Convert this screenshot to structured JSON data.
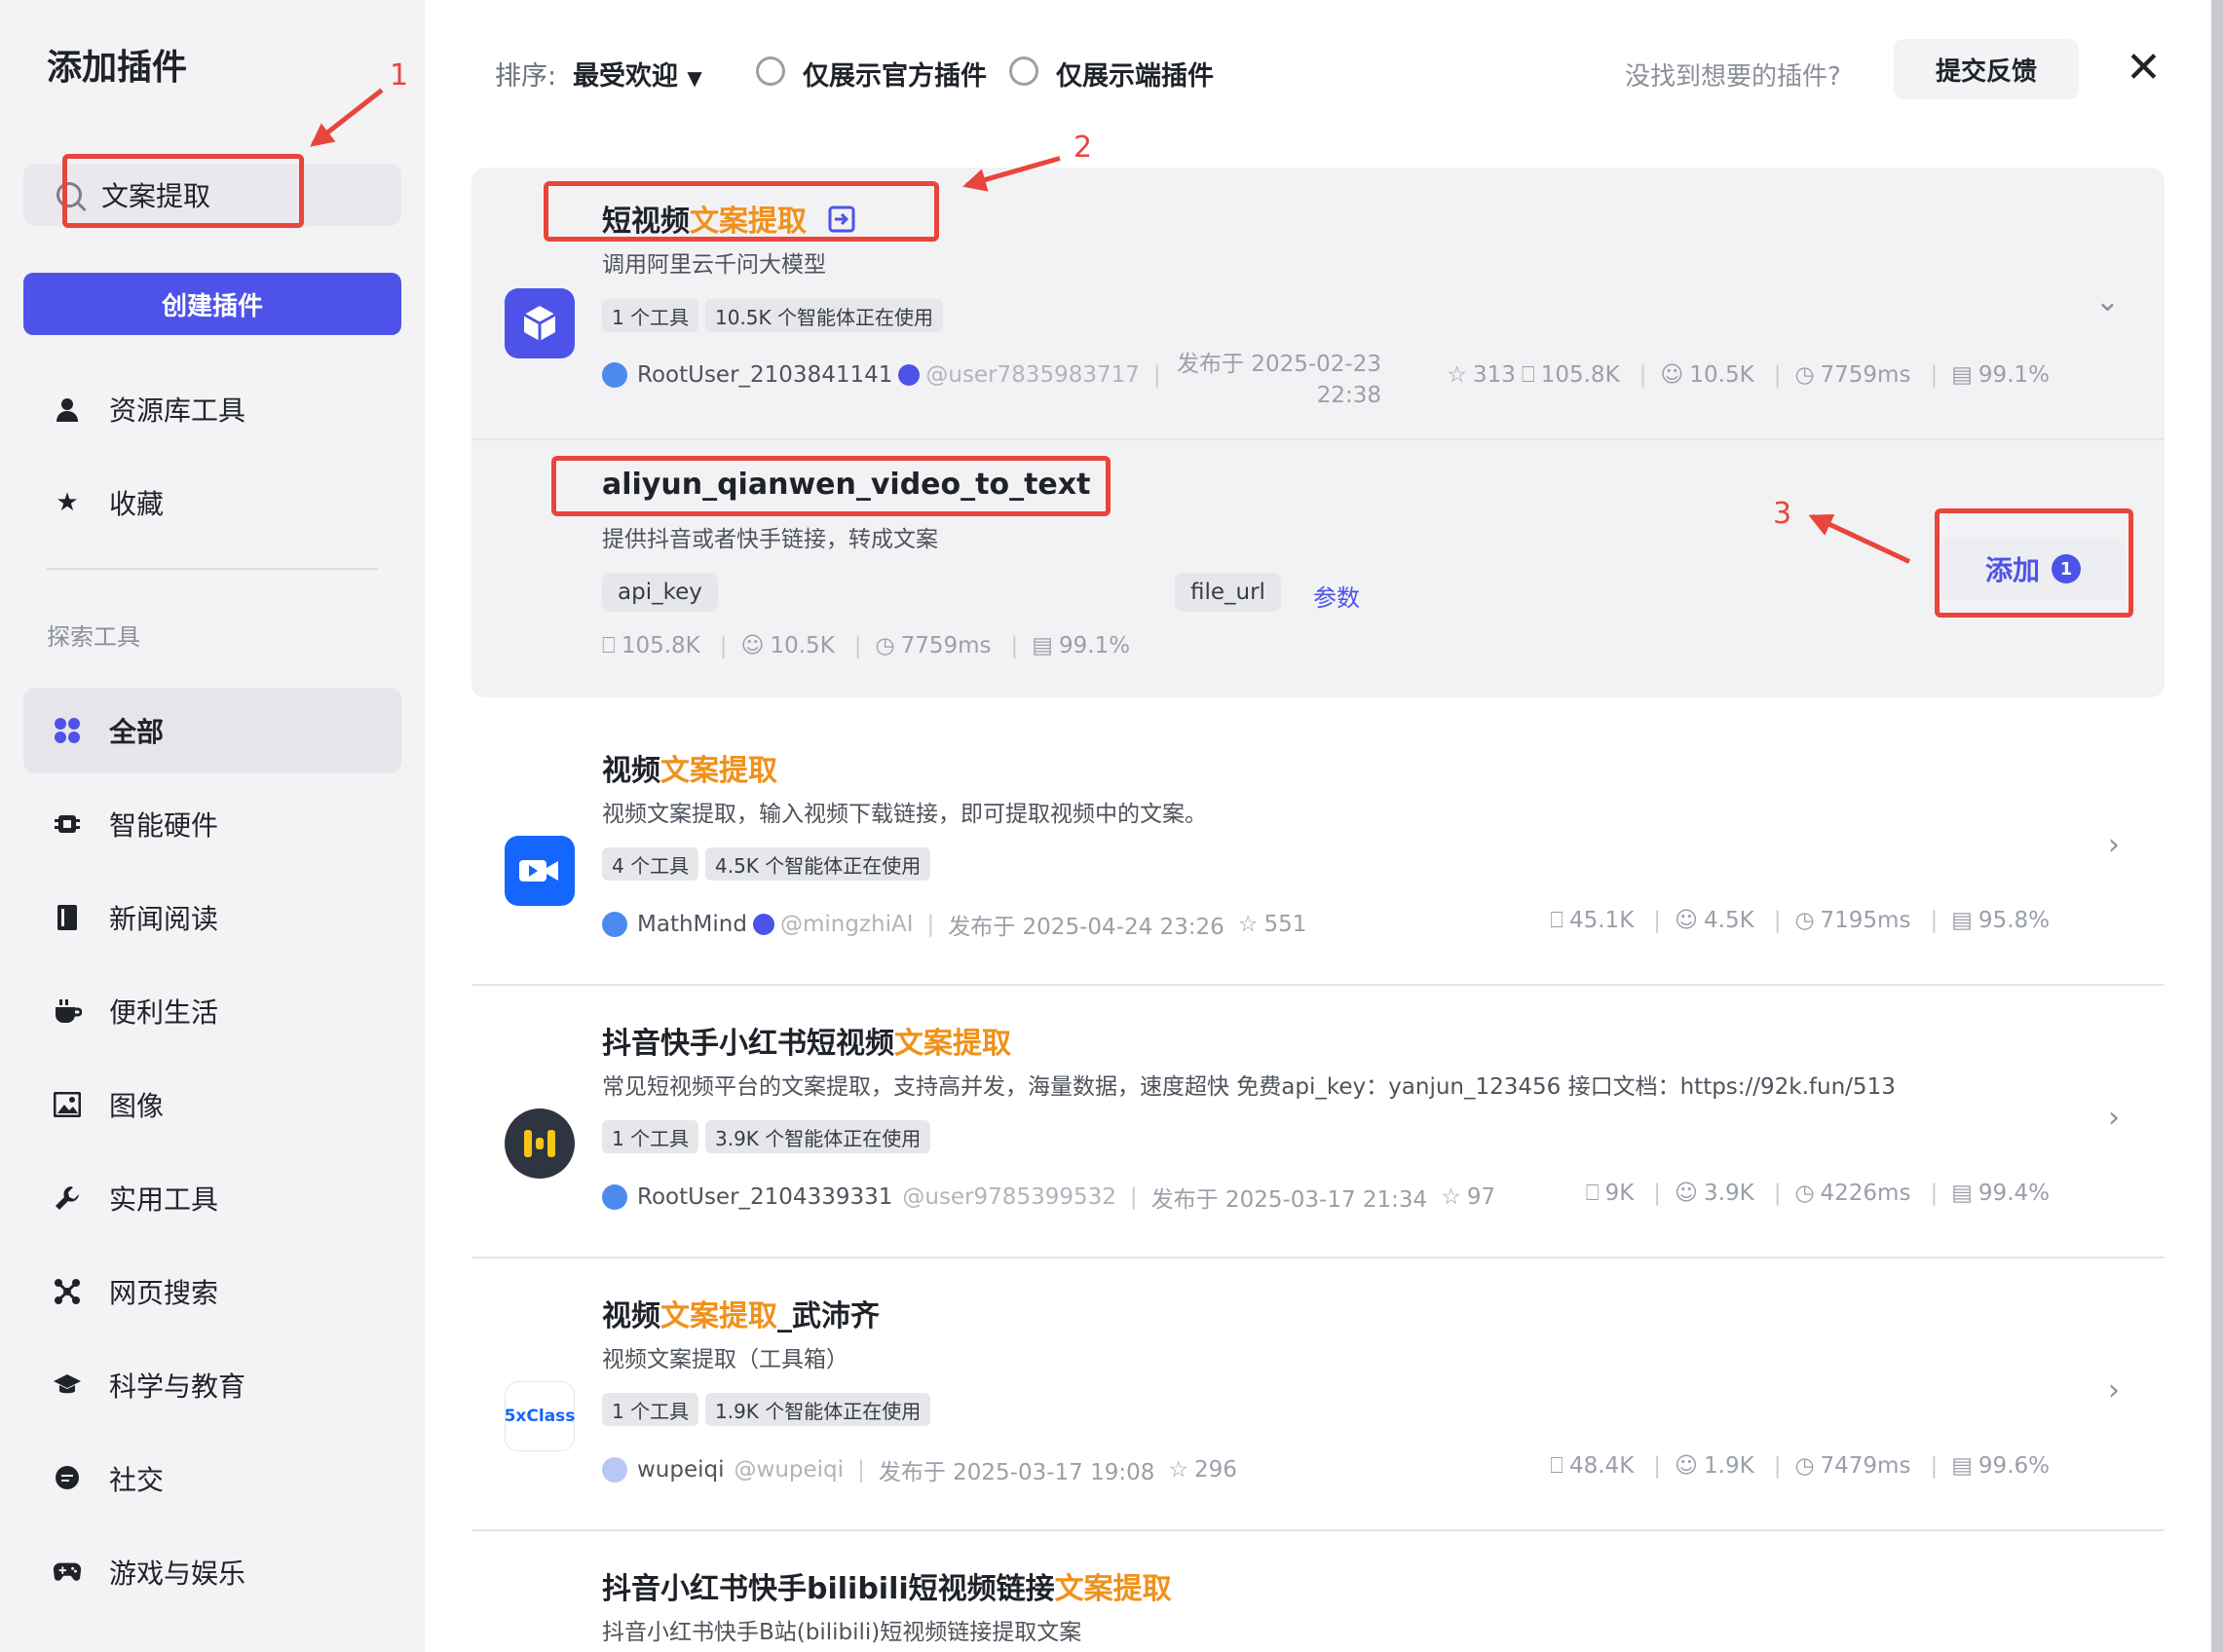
{
  "sidebar": {
    "title": "添加插件",
    "search_value": "文案提取",
    "create_label": "创建插件",
    "top_items": [
      {
        "label": "资源库工具",
        "icon": "person-icon"
      },
      {
        "label": "收藏",
        "icon": "star-icon"
      }
    ],
    "section_label": "探索工具",
    "items": [
      {
        "label": "全部",
        "icon": "grid-icon",
        "active": true
      },
      {
        "label": "智能硬件",
        "icon": "chip-icon"
      },
      {
        "label": "新闻阅读",
        "icon": "book-icon"
      },
      {
        "label": "便利生活",
        "icon": "coffee-icon"
      },
      {
        "label": "图像",
        "icon": "image-icon"
      },
      {
        "label": "实用工具",
        "icon": "wrench-icon"
      },
      {
        "label": "网页搜索",
        "icon": "network-icon"
      },
      {
        "label": "科学与教育",
        "icon": "graduation-cap-icon"
      },
      {
        "label": "社交",
        "icon": "chat-icon"
      },
      {
        "label": "游戏与娱乐",
        "icon": "gamepad-icon"
      }
    ]
  },
  "topbar": {
    "sort_label": "排序:",
    "sort_value": "最受欢迎",
    "filter_official": "仅展示官方插件",
    "filter_client": "仅展示端插件",
    "not_found": "没找到想要的插件?",
    "feedback": "提交反馈",
    "close": "✕"
  },
  "plugins": [
    {
      "title_pre": "短视频",
      "title_hl": "文案提取",
      "title_post": "",
      "desc": "调用阿里云千问大模型",
      "tags": [
        "1 个工具",
        "10.5K 个智能体正在使用"
      ],
      "author": "RootUser_2103841141",
      "handle": "@user7835983717",
      "published": "发布于 2025-02-23",
      "published_time": "22:38",
      "stars": "313",
      "s1": "105.8K",
      "s2": "10.5K",
      "s3": "7759ms",
      "s4": "99.1%",
      "logo_color": "#4d53e8"
    },
    {
      "title_pre": "视频",
      "title_hl": "文案提取",
      "title_post": "",
      "desc": "视频文案提取，输入视频下载链接，即可提取视频中的文案。",
      "tags": [
        "4 个工具",
        "4.5K 个智能体正在使用"
      ],
      "author": "MathMind",
      "handle": "@mingzhiAI",
      "published": "发布于 2025-04-24 23:26",
      "stars": "551",
      "s1": "45.1K",
      "s2": "4.5K",
      "s3": "7195ms",
      "s4": "95.8%",
      "logo_color": "#1565ff"
    },
    {
      "title_pre": "抖音快手小红书短视频",
      "title_hl": "文案提取",
      "title_post": "",
      "desc": "常见短视频平台的文案提取，支持高并发，海量数据，速度超快 免费api_key：yanjun_123456 接口文档：https://92k.fun/513",
      "tags": [
        "1 个工具",
        "3.9K 个智能体正在使用"
      ],
      "author": "RootUser_2104339331",
      "handle": "@user9785399532",
      "published": "发布于 2025-03-17 21:34",
      "stars": "97",
      "s1": "9K",
      "s2": "3.9K",
      "s3": "4226ms",
      "s4": "99.4%",
      "logo_color": "#2e3440"
    },
    {
      "title_pre": "视频",
      "title_hl": "文案提取",
      "title_post": "_武沛齐",
      "desc": "视频文案提取（工具箱）",
      "tags": [
        "1 个工具",
        "1.9K 个智能体正在使用"
      ],
      "author": "wupeiqi",
      "handle": "@wupeiqi",
      "published": "发布于 2025-03-17 19:08",
      "stars": "296",
      "s1": "48.4K",
      "s2": "1.9K",
      "s3": "7479ms",
      "s4": "99.6%",
      "logo_text": "5xClass"
    },
    {
      "title_pre": "抖音小红书快手bilibili短视频链接",
      "title_hl": "文案提取",
      "title_post": "",
      "desc": "抖音小红书快手B站(bilibili)短视频链接提取文案"
    }
  ],
  "tool": {
    "name": "aliyun_qianwen_video_to_text",
    "desc": "提供抖音或者快手链接，转成文案",
    "params": [
      "api_key",
      "file_url"
    ],
    "param_link": "参数",
    "s1": "105.8K",
    "s2": "10.5K",
    "s3": "7759ms",
    "s4": "99.1%",
    "add_label": "添加",
    "add_badge": "1"
  },
  "annotations": [
    "1",
    "2",
    "3"
  ],
  "colors": {
    "accent": "#4d53e8",
    "highlight": "#f0911b",
    "annotation": "#e8453c"
  }
}
